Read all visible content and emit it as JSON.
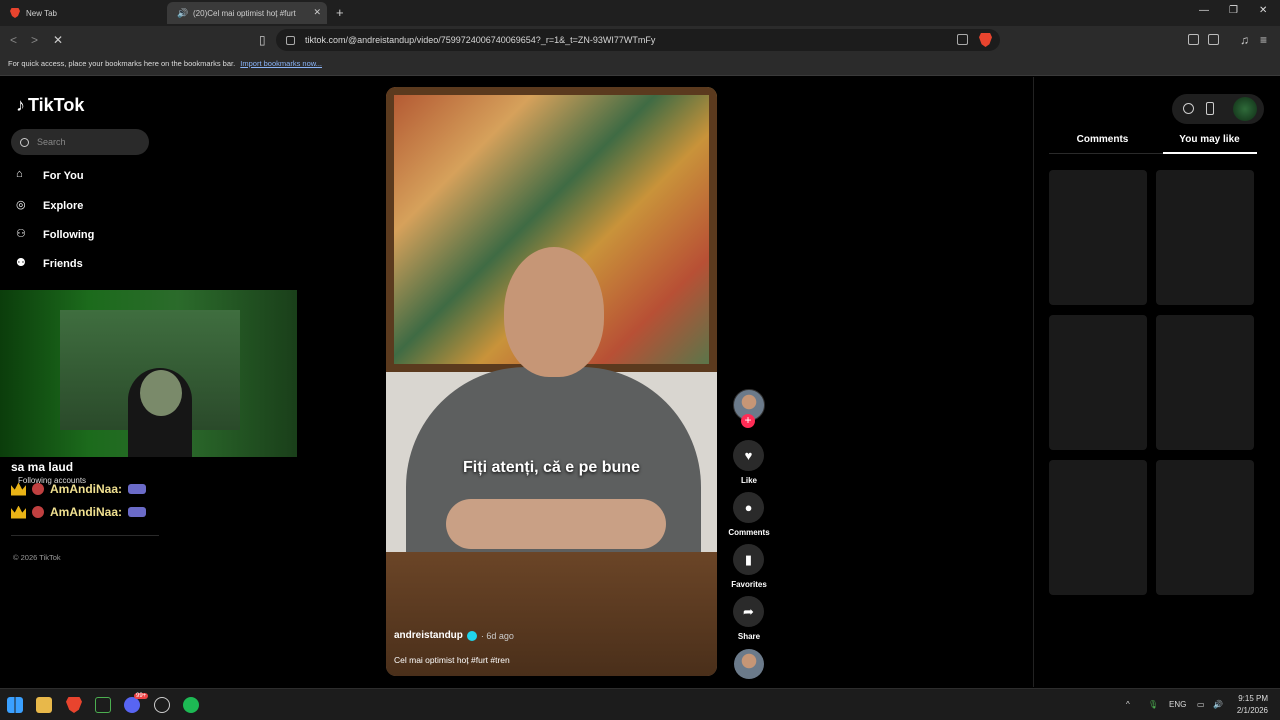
{
  "browser": {
    "tabs": [
      {
        "title": "New Tab"
      },
      {
        "title": "(20)Cel mai optimist hoț #furt"
      }
    ],
    "url": "tiktok.com/@andreistandup/video/7599724006740069654?_r=1&_t=ZN-93WI77WTmFy",
    "bookmarks_message": "For quick access, place your bookmarks here on the bookmarks bar.",
    "bookmarks_link": "Import bookmarks now...",
    "icons": {
      "minimize": "minimize-icon",
      "maximize": "maximize-icon",
      "close": "close-icon"
    }
  },
  "tiktok": {
    "logo": "TikTok",
    "search_placeholder": "Search",
    "nav": [
      {
        "label": "For You",
        "icon": "home-icon"
      },
      {
        "label": "Explore",
        "icon": "compass-icon"
      },
      {
        "label": "Following",
        "icon": "user-follow-icon"
      },
      {
        "label": "Friends",
        "icon": "friends-icon"
      }
    ],
    "following_accounts": "Following accounts",
    "copyright": "© 2026 TikTok"
  },
  "overlay_chat": {
    "message": "sa ma laud",
    "rows": [
      {
        "user": "AmAndiNaa:"
      },
      {
        "user": "AmAndiNaa:"
      }
    ]
  },
  "video": {
    "subtitle": "Fiți atenți, că e pe bune",
    "author": "andreistandup",
    "time": "· 6d ago",
    "caption": "Cel mai optimist hoț #furt #tren"
  },
  "actions": {
    "like": "Like",
    "comments": "Comments",
    "favorites": "Favorites",
    "share": "Share"
  },
  "right_panel": {
    "tabs": [
      "Comments",
      "You may like"
    ],
    "active_tab": "You may like"
  },
  "taskbar": {
    "language": "ENG",
    "time": "9:15 PM",
    "date": "2/1/2026",
    "discord_badge": "99+"
  },
  "colors": {
    "accent": "#fe2c55",
    "verified": "#20d5ec",
    "page_bg": "#000000"
  }
}
